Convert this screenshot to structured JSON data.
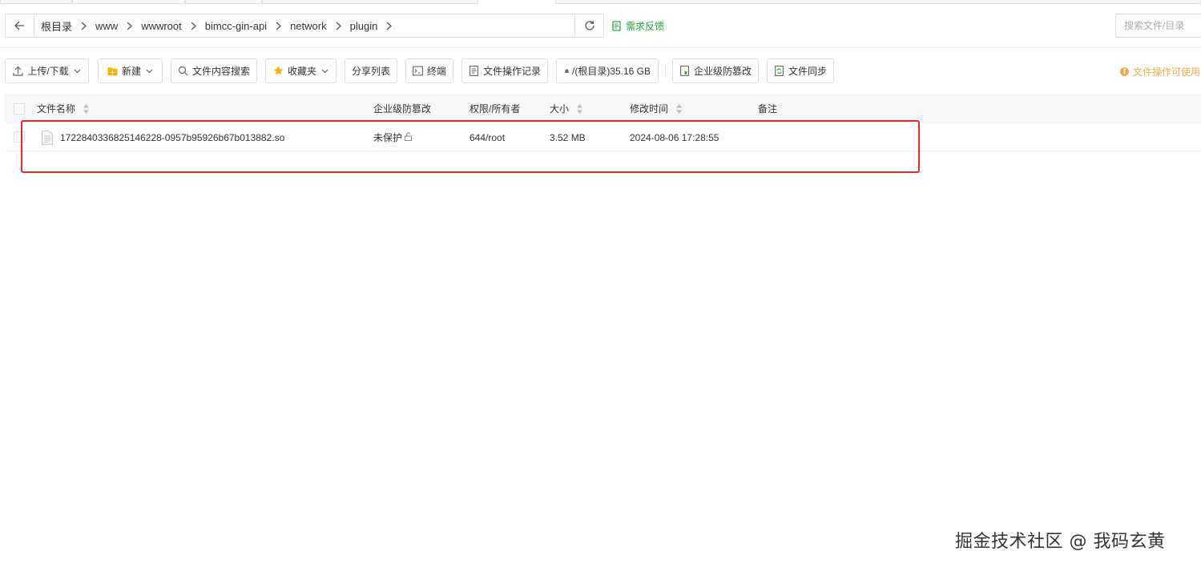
{
  "breadcrumb": [
    "根目录",
    "www",
    "wwwroot",
    "bimcc-gin-api",
    "network",
    "plugin"
  ],
  "feedback_label": "需求反馈",
  "search": {
    "placeholder": "搜索文件/目录"
  },
  "toolbar": {
    "upload_download": "上传/下载",
    "new": "新建",
    "content_search": "文件内容搜索",
    "favorites": "收藏夹",
    "share_list": "分享列表",
    "terminal": "终端",
    "operation_log": "文件操作记录",
    "disk": "/(根目录)35.16 GB",
    "tamper_proof": "企业级防篡改",
    "file_sync": "文件同步"
  },
  "notice": "文件操作可使用",
  "table": {
    "columns": [
      "文件名称",
      "企业级防篡改",
      "权限/所有者",
      "大小",
      "修改时间",
      "备注"
    ],
    "rows": [
      {
        "name": "1722840336825146228-0957b95926b67b013882.so",
        "protection": "未保护",
        "permission": "644/root",
        "size": "3.52 MB",
        "modified": "2024-08-06 17:28:55",
        "note": ""
      }
    ]
  },
  "watermark": "掘金技术社区 @ 我码玄黄",
  "colors": {
    "accent_green": "#20a53a",
    "warning_orange": "#f0ad4e",
    "highlight_red": "#e8282b",
    "folder_yellow": "#f5b400"
  }
}
